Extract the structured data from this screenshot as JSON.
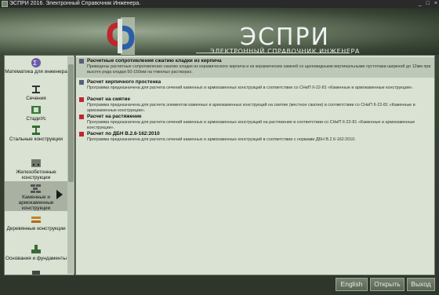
{
  "window": {
    "title": "ЭСПРИ 2016. Электронный Справочник Инженера.",
    "controls": [
      "_",
      "□",
      "×"
    ]
  },
  "brand": {
    "title": "ЭСПРИ",
    "subtitle": "ЭЛЕКТРОННЫЙ СПРАВОЧНИК ИНЖЕНЕРА"
  },
  "sidebar": {
    "items": [
      {
        "label": "Математика для инженера",
        "icon": "math-icon"
      },
      {
        "label": "Сечения",
        "icon": "section-icon"
      },
      {
        "label": "СтадиУс",
        "icon": "stadius-icon"
      },
      {
        "label": "Стальные конструкции",
        "icon": "steel-icon"
      },
      {
        "label": "Железобетонные конструкции",
        "icon": "concrete-icon"
      },
      {
        "label": "Каменные и армокаменные конструкции",
        "icon": "masonry-icon"
      },
      {
        "label": "Деревянные конструкции",
        "icon": "timber-icon"
      },
      {
        "label": "Основания и фундаменты",
        "icon": "foundation-icon"
      }
    ],
    "selected": "Каменные и армокаменные конструкции"
  },
  "entries": [
    {
      "title": "Расчетные сопротивления сжатию кладки из кирпича",
      "desc": "Приведены расчетные сопротивления сжатию кладки из керамического кирпича и из керамических камней со щелевидными вертикальными пустотами шириной до 12мм при высоте ряда кладки 50-150мм на тяжелых растворах."
    },
    {
      "title": "Расчет кирпичного простенка",
      "desc": "Программа предназначена для расчета сечений каменных и армокаменных конструкций в соответствии со СНиП II-22-81 «Каменные и армокаменные конструкции»."
    },
    {
      "title": "Расчет на смятие",
      "desc": "Программа предназначена для расчета элементов каменных и армокаменных конструкций на смятие (местное сжатие) в соответствии со СНиП II-22-81 «Каменные и армокаменные конструкции»."
    },
    {
      "title": "Расчет на растяжение",
      "desc": "Программа предназначена для расчета сечений каменных и армокаменных конструкций на растяжение в соответствии со СНиП II-22-81 «Каменные и армокаменные конструкции»."
    },
    {
      "title": "Расчет по ДБН В.2.6-162:2010",
      "desc": "Программа предназначена для расчета сечений каменных и армокаменных конструкций в соответствии с нормами ДБН В.2.6-162:2010."
    }
  ],
  "buttons": {
    "english": "English",
    "open": "Открыть",
    "exit": "Выход"
  },
  "colors": {
    "accent_red": "#c0262c",
    "accent_blue": "#2a5fa8",
    "panel": "#d9e2d3"
  }
}
